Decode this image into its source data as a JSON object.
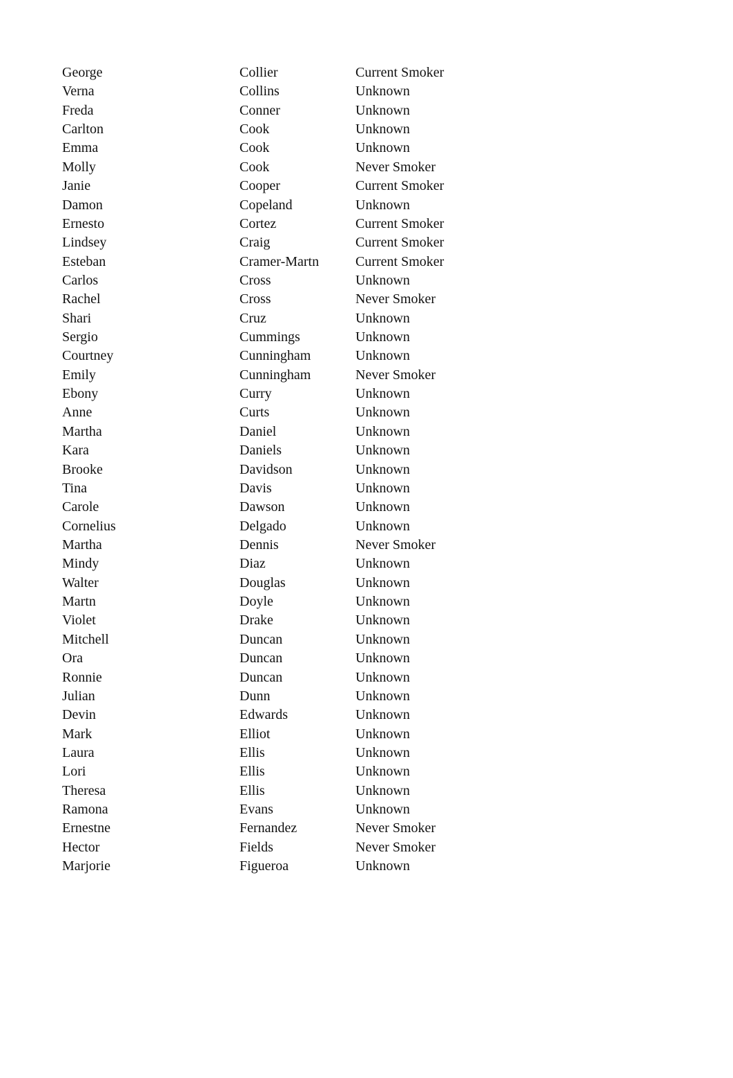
{
  "rows": [
    [
      "George",
      "Collier",
      "Current Smoker"
    ],
    [
      "Verna",
      "Collins",
      "Unknown"
    ],
    [
      "Freda",
      "Conner",
      "Unknown"
    ],
    [
      "Carlton",
      "Cook",
      "Unknown"
    ],
    [
      "Emma",
      "Cook",
      "Unknown"
    ],
    [
      "Molly",
      "Cook",
      "Never Smoker"
    ],
    [
      "Janie",
      "Cooper",
      "Current Smoker"
    ],
    [
      "Damon",
      "Copeland",
      "Unknown"
    ],
    [
      "Ernesto",
      "Cortez",
      "Current Smoker"
    ],
    [
      "Lindsey",
      "Craig",
      "Current Smoker"
    ],
    [
      "Esteban",
      "Cramer-Martn",
      "Current Smoker"
    ],
    [
      "Carlos",
      "Cross",
      "Unknown"
    ],
    [
      "Rachel",
      "Cross",
      "Never Smoker"
    ],
    [
      "Shari",
      "Cruz",
      "Unknown"
    ],
    [
      "Sergio",
      "Cummings",
      "Unknown"
    ],
    [
      "Courtney",
      "Cunningham",
      "Unknown"
    ],
    [
      "Emily",
      "Cunningham",
      "Never Smoker"
    ],
    [
      "Ebony",
      "Curry",
      "Unknown"
    ],
    [
      "Anne",
      "Curts",
      "Unknown"
    ],
    [
      "Martha",
      "Daniel",
      "Unknown"
    ],
    [
      "Kara",
      "Daniels",
      "Unknown"
    ],
    [
      "Brooke",
      "Davidson",
      "Unknown"
    ],
    [
      "Tina",
      "Davis",
      "Unknown"
    ],
    [
      "Carole",
      "Dawson",
      "Unknown"
    ],
    [
      "Cornelius",
      "Delgado",
      "Unknown"
    ],
    [
      "Martha",
      "Dennis",
      "Never Smoker"
    ],
    [
      "Mindy",
      "Diaz",
      "Unknown"
    ],
    [
      "Walter",
      "Douglas",
      "Unknown"
    ],
    [
      "Martn",
      "Doyle",
      "Unknown"
    ],
    [
      "Violet",
      "Drake",
      "Unknown"
    ],
    [
      "Mitchell",
      "Duncan",
      "Unknown"
    ],
    [
      "Ora",
      "Duncan",
      "Unknown"
    ],
    [
      "Ronnie",
      "Duncan",
      "Unknown"
    ],
    [
      "Julian",
      "Dunn",
      "Unknown"
    ],
    [
      "Devin",
      "Edwards",
      "Unknown"
    ],
    [
      "Mark",
      "Elliot",
      "Unknown"
    ],
    [
      "Laura",
      "Ellis",
      "Unknown"
    ],
    [
      "Lori",
      "Ellis",
      "Unknown"
    ],
    [
      "Theresa",
      "Ellis",
      "Unknown"
    ],
    [
      "Ramona",
      "Evans",
      "Unknown"
    ],
    [
      "Ernestne",
      "Fernandez",
      "Never Smoker"
    ],
    [
      "Hector",
      "Fields",
      "Never Smoker"
    ],
    [
      "Marjorie",
      "Figueroa",
      "Unknown"
    ]
  ]
}
